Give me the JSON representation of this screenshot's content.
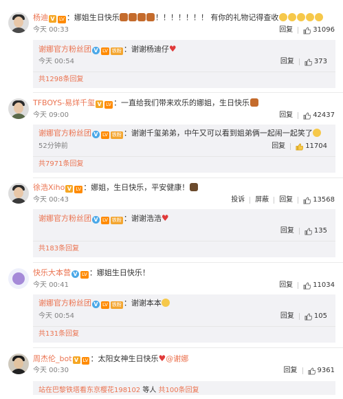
{
  "comments": [
    {
      "user": "杨迪",
      "text_prefix": "：娜姐生日快乐",
      "text_suffix": "！！！！！！！ 有你的礼物记得查收",
      "time": "今天 00:33",
      "reply_label": "回复",
      "likes": "31096",
      "reply": {
        "user": "谢娜官方粉丝团",
        "text": "：谢谢杨迪仔",
        "time": "今天 00:54",
        "reply_label": "回复",
        "likes": "373"
      },
      "more": "共1298条回复"
    },
    {
      "user": "TFBOYS-易烊千玺",
      "text": "：一直给我们带来欢乐的娜姐，生日快乐",
      "time": "今天 09:00",
      "reply_label": "回复",
      "likes": "42437",
      "reply": {
        "user": "谢娜官方粉丝团",
        "text": "：谢谢千玺弟弟，中午又可以看到姐弟俩一起闹一起笑了",
        "time": "52分钟前",
        "reply_label": "回复",
        "likes": "11704"
      },
      "more": "共7971条回复"
    },
    {
      "user": "徐浩Xiho",
      "text": "：娜姐，生日快乐，平安健康！",
      "time": "今天 00:43",
      "report_label": "投诉",
      "block_label": "屏蔽",
      "reply_label": "回复",
      "likes": "13568",
      "reply": {
        "user": "谢娜官方粉丝团",
        "text": "：谢谢浩浩",
        "time": "今天 00:54",
        "reply_label": "回复",
        "likes": "135"
      },
      "more": "共183条回复"
    },
    {
      "user": "快乐大本营",
      "text": "：娜姐生日快乐！",
      "time": "今天 00:41",
      "reply_label": "回复",
      "likes": "11034",
      "reply": {
        "user": "谢娜官方粉丝团",
        "text": "：谢谢本本",
        "time": "今天 00:54",
        "reply_label": "回复",
        "likes": "105"
      },
      "more": "共131条回复"
    },
    {
      "user": "周杰伦_bot",
      "text": "：太阳女神生日快乐",
      "mention": "@谢娜",
      "time": "今天 00:30",
      "reply_label": "回复",
      "likes": "9361"
    }
  ],
  "badges": {
    "v": "V",
    "lv": "LV",
    "fan": "铁粉"
  },
  "footer": {
    "link": "站在巴黎铁塔看东京樱花198102",
    "middle": " 等人 ",
    "count": "共100条回复"
  },
  "colors": {
    "username": "#eb7350",
    "reply_bg": "#f2f2f5",
    "meta": "#808080"
  }
}
